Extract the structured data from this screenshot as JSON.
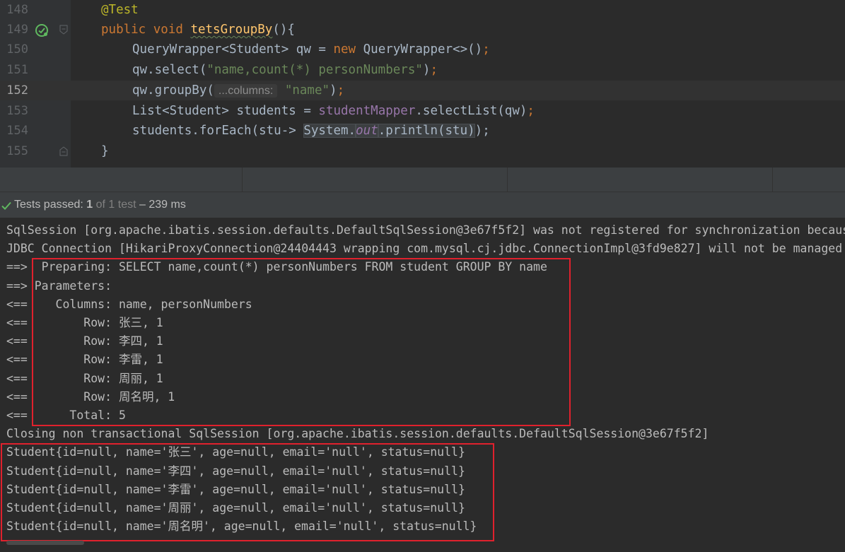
{
  "editor": {
    "lines": [
      {
        "num": "148",
        "segments": [
          {
            "t": "@Test",
            "c": "ann"
          }
        ]
      },
      {
        "num": "149",
        "segments": [
          {
            "t": "public void ",
            "c": "kw"
          },
          {
            "t": "tetsGroupBy",
            "c": "fn wavy"
          },
          {
            "t": "(){",
            "c": ""
          }
        ]
      },
      {
        "num": "150",
        "segments": [
          {
            "t": "QueryWrapper<Student> qw = ",
            "c": ""
          },
          {
            "t": "new ",
            "c": "kw"
          },
          {
            "t": "QueryWrapper<>()",
            "c": ""
          },
          {
            "t": ";",
            "c": "kw"
          }
        ]
      },
      {
        "num": "151",
        "segments": [
          {
            "t": "qw.select(",
            "c": ""
          },
          {
            "t": "\"name,count(*) personNumbers\"",
            "c": "str"
          },
          {
            "t": ")",
            "c": ""
          },
          {
            "t": ";",
            "c": "kw"
          }
        ]
      },
      {
        "num": "152",
        "segments": [
          {
            "t": "qw.groupBy(",
            "c": ""
          },
          {
            "t": "...columns:",
            "c": "hint"
          },
          {
            "t": " ",
            "c": ""
          },
          {
            "t": "\"name\"",
            "c": "str"
          },
          {
            "t": ")",
            "c": ""
          },
          {
            "t": ";",
            "c": "kw"
          }
        ]
      },
      {
        "num": "153",
        "segments": [
          {
            "t": "List<Student> students = ",
            "c": ""
          },
          {
            "t": "studentMapper",
            "c": "fld"
          },
          {
            "t": ".selectList(qw)",
            "c": ""
          },
          {
            "t": ";",
            "c": "kw"
          }
        ]
      },
      {
        "num": "154",
        "segments": [
          {
            "t": "students.forEach(stu-> ",
            "c": ""
          },
          {
            "t": "System.",
            "c": "hl"
          },
          {
            "t": "out",
            "c": "itf hl"
          },
          {
            "t": ".println(stu)",
            "c": "hl"
          },
          {
            "t": ");",
            "c": ""
          }
        ]
      },
      {
        "num": "155",
        "segments": [
          {
            "t": "}",
            "c": ""
          }
        ]
      }
    ]
  },
  "status": {
    "label": "Tests passed: ",
    "count": "1",
    "of": " of 1 test",
    "duration": " – 239 ms"
  },
  "console": {
    "lines": [
      "SqlSession [org.apache.ibatis.session.defaults.DefaultSqlSession@3e67f5f2] was not registered for synchronization because",
      "JDBC Connection [HikariProxyConnection@24404443 wrapping com.mysql.cj.jdbc.ConnectionImpl@3fd9e827] will not be managed",
      "==>  Preparing: SELECT name,count(*) personNumbers FROM student GROUP BY name",
      "==> Parameters: ",
      "<==    Columns: name, personNumbers",
      "<==        Row: 张三, 1",
      "<==        Row: 李四, 1",
      "<==        Row: 李雷, 1",
      "<==        Row: 周丽, 1",
      "<==        Row: 周名明, 1",
      "<==      Total: 5",
      "Closing non transactional SqlSession [org.apache.ibatis.session.defaults.DefaultSqlSession@3e67f5f2]",
      "Student{id=null, name='张三', age=null, email='null', status=null}",
      "Student{id=null, name='李四', age=null, email='null', status=null}",
      "Student{id=null, name='李雷', age=null, email='null', status=null}",
      "Student{id=null, name='周丽', age=null, email='null', status=null}",
      "Student{id=null, name='周名明', age=null, email='null', status=null}"
    ]
  },
  "colors": {
    "highlight_box": "#e0212d",
    "pass_green": "#5fb85f"
  },
  "icons": {
    "run": "test-passed-run-icon",
    "fold": "fold-marker-icon",
    "status": "check-icon"
  }
}
